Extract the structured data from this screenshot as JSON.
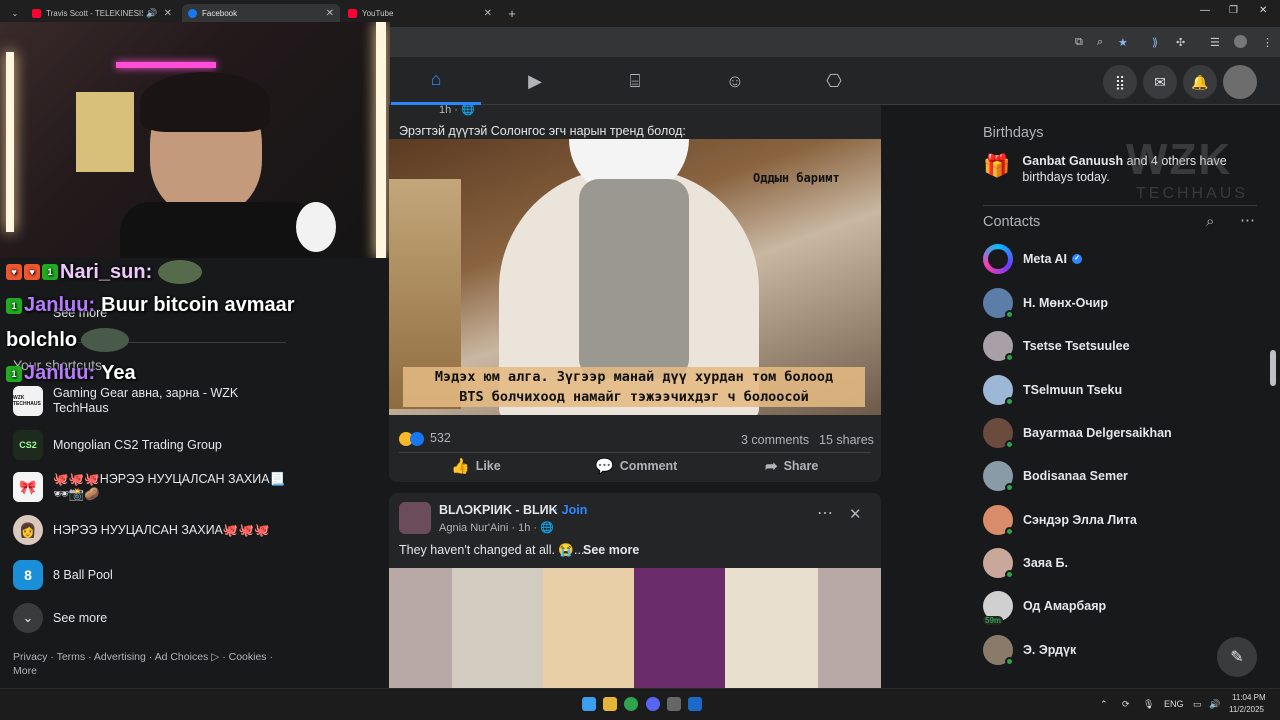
{
  "browser": {
    "tabs": [
      {
        "title": "Travis Scott - TELEKINESIS (",
        "fav_color": "#ff0033"
      },
      {
        "title": "Facebook",
        "fav_color": "#1877f2"
      },
      {
        "title": "YouTube",
        "fav_color": "#ff0033"
      }
    ],
    "new_tab": "+",
    "win_min": "—",
    "win_max": "❐",
    "win_close": "✕"
  },
  "stream_chat": [
    {
      "user": "Nari_sun:",
      "message": ""
    },
    {
      "user": "Janluu:",
      "message": "Buur bitcoin avmaar"
    },
    {
      "user": "",
      "message": "bolchlo"
    },
    {
      "user": "Janluu:",
      "message": "Yea"
    }
  ],
  "left_sidebar": {
    "see_more_top": "See more",
    "shortcuts_title": "Your shortcuts",
    "shortcuts": [
      {
        "label": "Gaming Gear авна, зарна - WZK TechHaus",
        "icon_text": "WZK TECHHAUS",
        "icon_bg": "#f2f2f2"
      },
      {
        "label": "Mongolian CS2 Trading Group",
        "icon_text": "CS2",
        "icon_bg": "#1d2a1d"
      },
      {
        "label": "🐙🐙🐙НЭРЭЭ НУУЦАЛСАН ЗАХИА📃 🕶📸🥔",
        "icon_text": "🎀",
        "icon_bg": "#f5f5f5"
      },
      {
        "label": "НЭРЭЭ НУУЦАЛСАН ЗАХИА🐙🐙🐙",
        "icon_text": "👩",
        "icon_bg": "#d8c8bd"
      },
      {
        "label": "8 Ball Pool",
        "icon_text": "8",
        "icon_bg": "#1a8fd8"
      }
    ],
    "see_more_bottom": "See more",
    "footer": "Privacy · Terms · Advertising · Ad Choices ▷ · Cookies · More"
  },
  "feed": {
    "post1": {
      "time": "1h · 🌐",
      "text": "Эрэгтэй дүүтэй Солонгос эгч нарын тренд болод:",
      "image_caption_top": "Оддын баримт",
      "image_caption_bottom_1": "Мэдэх юм алга. Зүгээр манай дүү хурдан том болоод",
      "image_caption_bottom_2": "BTS болчихоод намайг тэжээчихдэг ч болоосой",
      "reactions_count": "532",
      "comments": "3 comments",
      "shares": "15 shares",
      "like": "Like",
      "comment": "Comment",
      "share": "Share"
    },
    "post2": {
      "group": "BLΛƆKPIИK - BLИK",
      "join": "· Join",
      "author": "Agnia Nur'Aini · 1h · 🌐",
      "text": "They haven't changed at all. 😭...",
      "see_more": "See more"
    }
  },
  "right_sidebar": {
    "birthdays_title": "Birthdays",
    "birthday_name": "Ganbat Ganuush",
    "birthday_rest": "and 4 others have birthdays today.",
    "watermark_big": "WZK",
    "watermark_small": "TECHHAUS",
    "contacts_title": "Contacts",
    "contacts": [
      {
        "name": "Meta AI",
        "color": "#6b3cff",
        "verified": true,
        "online": false,
        "badge": ""
      },
      {
        "name": "Н. Мөнх-Очир",
        "color": "#5b7da8",
        "online": true,
        "badge": ""
      },
      {
        "name": "Tsetse Tsetsuulee",
        "color": "#a8a0a6",
        "online": true,
        "badge": ""
      },
      {
        "name": "TSelmuun Tseku",
        "color": "#9cb8d6",
        "online": true,
        "badge": ""
      },
      {
        "name": "Bayarmaa Delgersaikhan",
        "color": "#6b4b3e",
        "online": true,
        "badge": ""
      },
      {
        "name": "Bodisanaa Semer",
        "color": "#8a9ba8",
        "online": true,
        "badge": ""
      },
      {
        "name": "Сэндэр Элла Лита",
        "color": "#d98c6a",
        "online": true,
        "badge": ""
      },
      {
        "name": "Заяа Б.",
        "color": "#c9a79b",
        "online": true,
        "badge": ""
      },
      {
        "name": "Од Амарбаяр",
        "color": "#d0d0d0",
        "online": false,
        "badge": "59m"
      },
      {
        "name": "Э. Эрдүк",
        "color": "#8a7a6a",
        "online": true,
        "badge": ""
      }
    ]
  },
  "taskbar": {
    "lang": "ENG",
    "time": "11:04 PM",
    "date": "11/2/2025"
  }
}
